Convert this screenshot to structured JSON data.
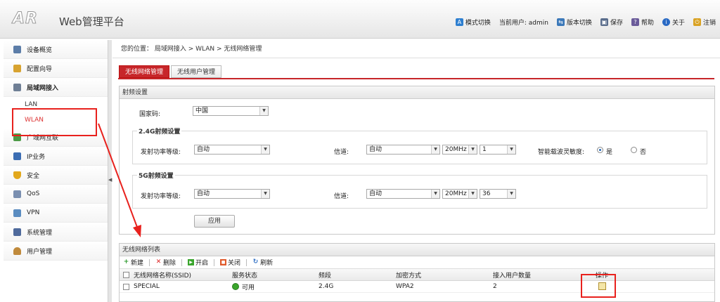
{
  "header": {
    "logo": "AR",
    "title": "Web管理平台",
    "nav": [
      {
        "label": "模式切换",
        "icon": "mode-switch-icon"
      },
      {
        "label": "当前用户: admin",
        "icon": ""
      },
      {
        "label": "版本切换",
        "icon": "version-switch-icon"
      },
      {
        "label": "保存",
        "icon": "save-icon"
      },
      {
        "label": "帮助",
        "icon": "help-icon"
      },
      {
        "label": "关于",
        "icon": "about-icon"
      },
      {
        "label": "注销",
        "icon": "logout-icon"
      }
    ]
  },
  "sidebar": {
    "items": [
      {
        "label": "设备概览"
      },
      {
        "label": "配置向导"
      },
      {
        "label": "局域网接入"
      },
      {
        "label": "广域网互联"
      },
      {
        "label": "IP业务"
      },
      {
        "label": "安全"
      },
      {
        "label": "QoS"
      },
      {
        "label": "VPN"
      },
      {
        "label": "系统管理"
      },
      {
        "label": "用户管理"
      }
    ],
    "subitems": [
      {
        "label": "LAN"
      },
      {
        "label": "WLAN"
      }
    ]
  },
  "breadcrumb": "您的位置： 局域网接入 > WLAN > 无线网络管理",
  "tabs": [
    {
      "label": "无线网络管理"
    },
    {
      "label": "无线用户管理"
    }
  ],
  "radio": {
    "title": "射频设置",
    "country_label": "国家码:",
    "country_value": "中国",
    "g24": {
      "title": "2.4G射频设置",
      "power_label": "发射功率等级:",
      "power_value": "自动",
      "channel_label": "信道:",
      "channel_value": "自动",
      "bandwidth": "20MHz",
      "channel_num": "1",
      "sensitivity_label": "智能载波灵敏度:",
      "yes": "是",
      "no": "否"
    },
    "g5": {
      "title": "5G射频设置",
      "power_label": "发射功率等级:",
      "power_value": "自动",
      "channel_label": "信道:",
      "channel_value": "自动",
      "bandwidth": "20MHz",
      "channel_num": "36"
    },
    "apply_label": "应用"
  },
  "list": {
    "title": "无线网络列表",
    "toolbar": {
      "new": "新建",
      "delete": "删除",
      "enable": "开启",
      "disable": "关闭",
      "refresh": "刷新"
    },
    "columns": [
      "无线网络名称(SSID)",
      "服务状态",
      "频段",
      "加密方式",
      "接入用户数量",
      "操作"
    ],
    "rows": [
      {
        "ssid": "SPECIAL",
        "status": "可用",
        "band": "2.4G",
        "encryption": "WPA2",
        "users": "2"
      }
    ]
  },
  "colors": {
    "accent": "#c7262a",
    "annotation": "#e8211d",
    "status_ok": "#3aa52c"
  }
}
